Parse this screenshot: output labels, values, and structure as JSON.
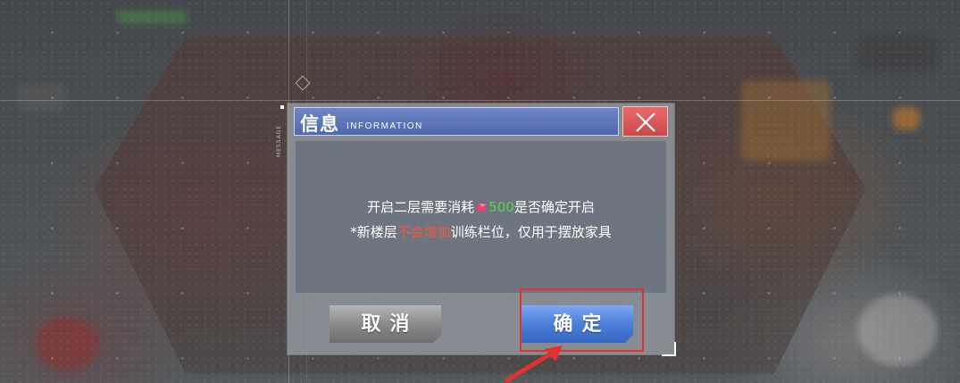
{
  "dialog": {
    "side_label": "MESSAGE",
    "title_cn": "信息",
    "title_en": "INFORMATION",
    "close_icon": "close-x-icon",
    "message_line1": {
      "before": "开启二层需要消耗",
      "currency_icon": "gem-icon",
      "cost": "500",
      "after": "是否确定开启"
    },
    "message_line2": {
      "before": "*新楼层",
      "warning": "不会增加",
      "after": "训练栏位，仅用于摆放家具"
    },
    "cancel_label": "取消",
    "confirm_label": "确定"
  },
  "colors": {
    "title_bar": "#5a73b9",
    "close_button": "#d85a5a",
    "cost_text": "#5ad24c",
    "warning_text": "#f1593b",
    "confirm_button": "#4c7fd9",
    "cancel_button": "#8a8a8a",
    "highlight": "#e53030"
  }
}
